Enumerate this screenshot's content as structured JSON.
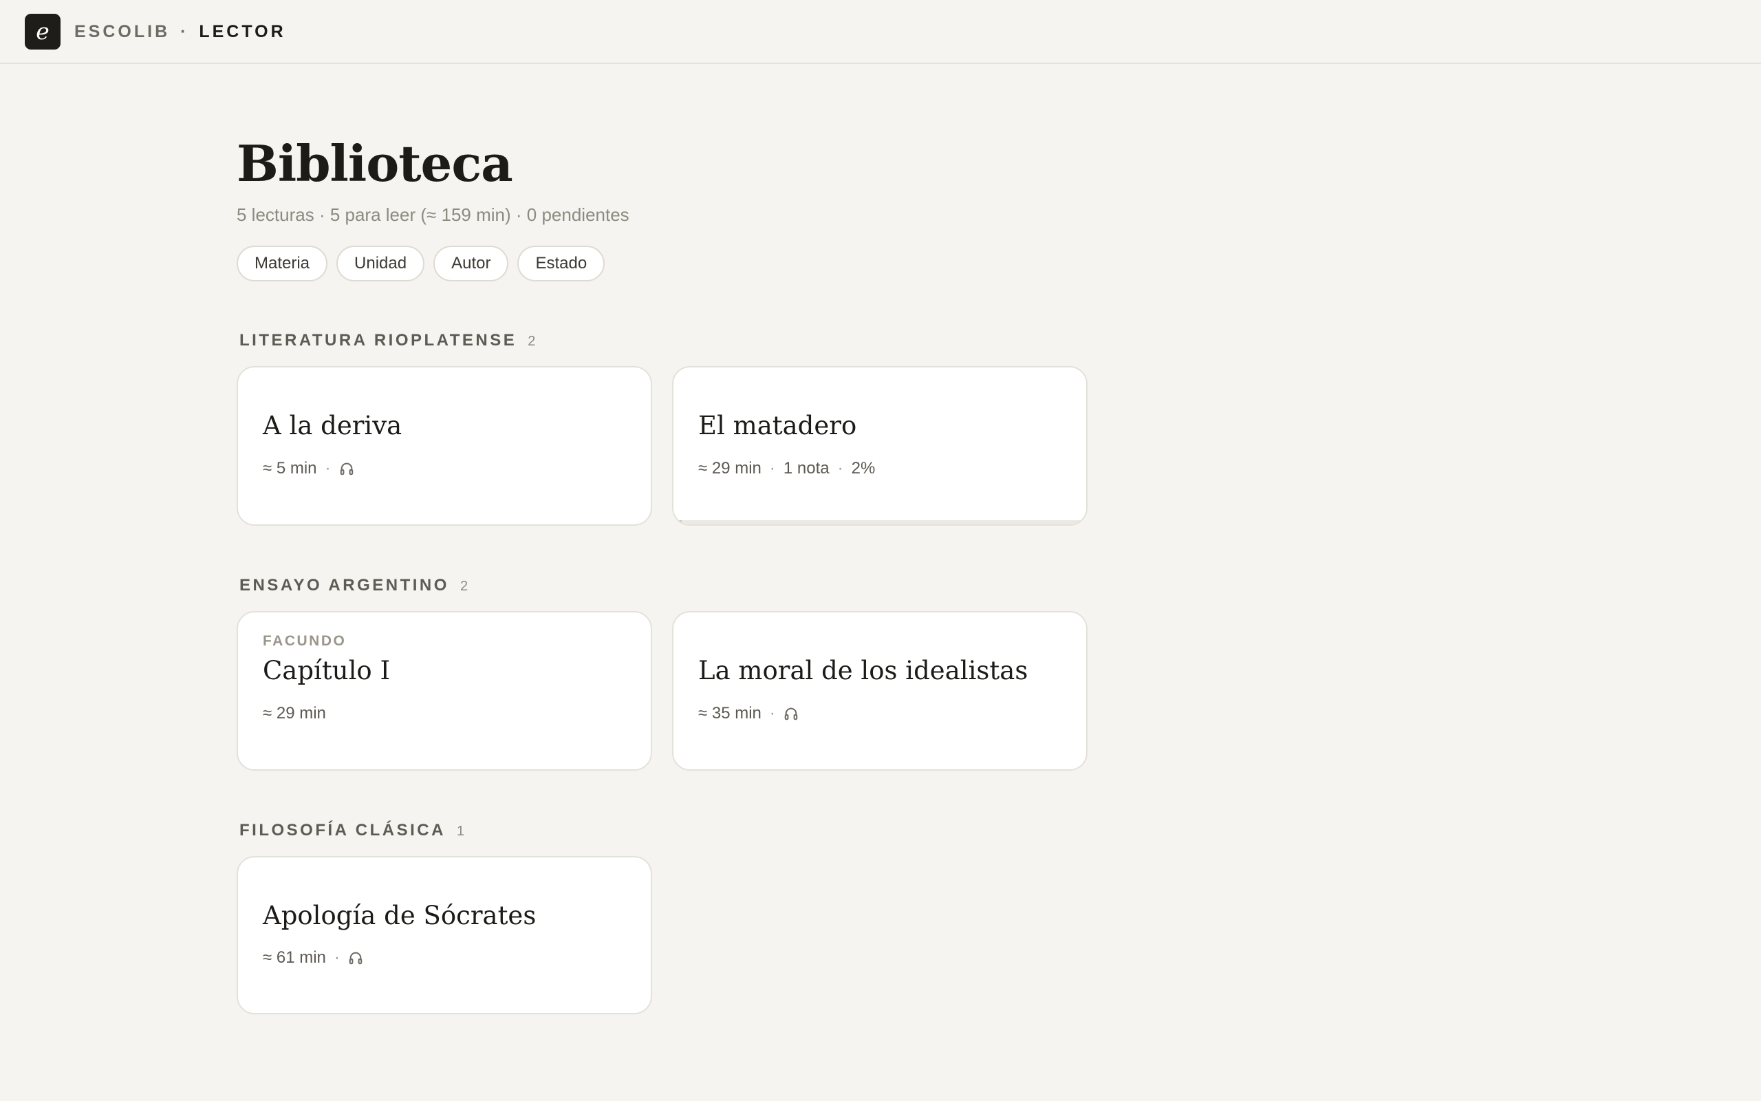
{
  "app": {
    "logo_letter": "e",
    "brand_name": "ESCOLIB",
    "brand_separator": "·",
    "brand_section": "LECTOR"
  },
  "header": {
    "title": "Biblioteca",
    "summary": "5 lecturas · 5 para leer (≈ 159 min) · 0 pendientes"
  },
  "filters": [
    "Materia",
    "Unidad",
    "Autor",
    "Estado"
  ],
  "sections": [
    {
      "title": "LITERATURA RIOPLATENSE",
      "count": "2",
      "cards": [
        {
          "kicker": "",
          "title": "A la deriva",
          "duration": "≈ 5 min",
          "notes": "",
          "progress_label": "",
          "audio": true,
          "progress": 0
        },
        {
          "kicker": "",
          "title": "El matadero",
          "duration": "≈ 29 min",
          "notes": "1 nota",
          "progress_label": "2%",
          "audio": false,
          "progress": 0.02
        }
      ]
    },
    {
      "title": "ENSAYO ARGENTINO",
      "count": "2",
      "cards": [
        {
          "kicker": "FACUNDO",
          "title": "Capítulo I",
          "duration": "≈ 29 min",
          "notes": "",
          "progress_label": "",
          "audio": false,
          "progress": 0
        },
        {
          "kicker": "",
          "title": "La moral de los idealistas",
          "duration": "≈ 35 min",
          "notes": "",
          "progress_label": "",
          "audio": true,
          "progress": 0
        }
      ]
    },
    {
      "title": "FILOSOFÍA CLÁSICA",
      "count": "1",
      "cards": [
        {
          "kicker": "",
          "title": "Apología de Sócrates",
          "duration": "≈ 61 min",
          "notes": "",
          "progress_label": "",
          "audio": true,
          "progress": 0
        }
      ]
    }
  ],
  "colors": {
    "background": "#f5f4f0",
    "card": "#ffffff",
    "text": "#1c1b18",
    "muted": "#8e8a80",
    "logo_bg": "#1f1d1a"
  }
}
